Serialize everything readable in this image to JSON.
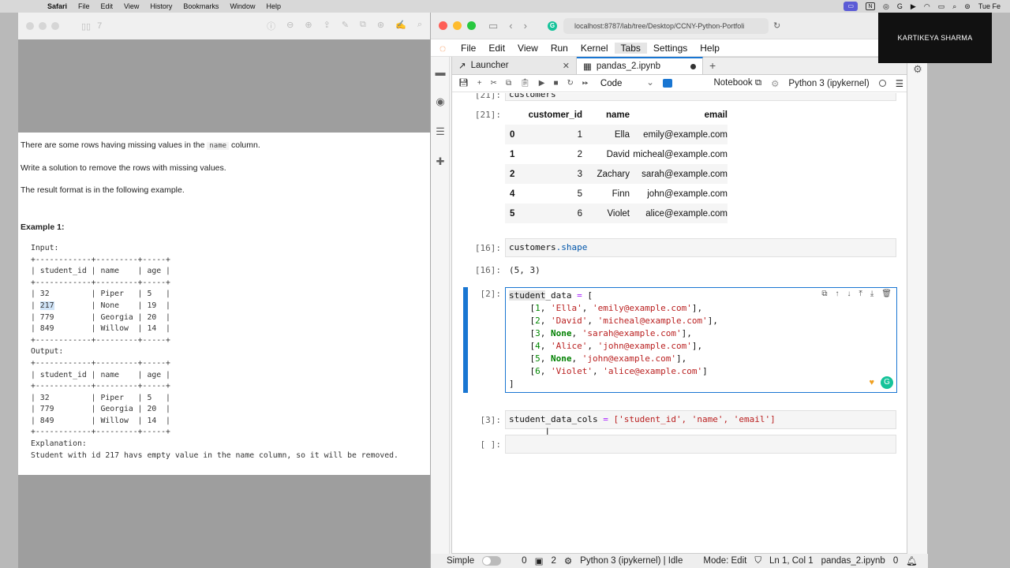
{
  "menubar": {
    "app": "Safari",
    "items": [
      "File",
      "Edit",
      "View",
      "History",
      "Bookmarks",
      "Window",
      "Help"
    ],
    "clock": "Tue Fe"
  },
  "safari_left": {
    "tab_count": "7",
    "problem": {
      "line1_pre": "There are some rows having missing values in the",
      "line1_code": "name",
      "line1_post": "column.",
      "line2": "Write a solution to remove the rows with missing values.",
      "line3": "The result format is in the following example.",
      "example_title": "Example 1:",
      "input_label": "Input:",
      "sep": "+------------+---------+-----+",
      "header": "| student_id | name    | age |",
      "input_rows": [
        [
          "| 32         | Piper   | 5   |"
        ],
        [
          "| ",
          "217",
          "        | None    | 19  |"
        ],
        [
          "| 779        | Georgia | 20  |"
        ],
        [
          "| 849        | Willow  | 14  |"
        ]
      ],
      "output_label": "Output:",
      "output_rows": [
        "| 32         | Piper   | 5   |",
        "| 779        | Georgia | 20  |",
        "| 849        | Willow  | 14  |"
      ],
      "explanation_label": "Explanation:",
      "explanation": "Student with id 217 havs empty value in the name column, so it will be removed."
    }
  },
  "browser": {
    "url": "localhost:8787/lab/tree/Desktop/CCNY-Python-Portfoli"
  },
  "jupyter": {
    "menu": [
      "File",
      "Edit",
      "View",
      "Run",
      "Kernel",
      "Tabs",
      "Settings",
      "Help"
    ],
    "tabs": [
      {
        "label": "Launcher"
      },
      {
        "label": "pandas_2.ipynb"
      }
    ],
    "toolbar": {
      "cell_type": "Code",
      "notebook_label": "Notebook",
      "kernel": "Python 3 (ipykernel)"
    },
    "cells": {
      "c21_top_text": "customers",
      "c21_prompt": "[21]:",
      "df_headers": [
        "",
        "customer_id",
        "name",
        "email"
      ],
      "df_rows": [
        [
          "0",
          "1",
          "Ella",
          "emily@example.com"
        ],
        [
          "1",
          "2",
          "David",
          "micheal@example.com"
        ],
        [
          "2",
          "3",
          "Zachary",
          "sarah@example.com"
        ],
        [
          "4",
          "5",
          "Finn",
          "john@example.com"
        ],
        [
          "5",
          "6",
          "Violet",
          "alice@example.com"
        ]
      ],
      "c16_prompt": "[16]:",
      "c16_code_var": "customers",
      "c16_code_attr": ".shape",
      "c16_out_prompt": "[16]:",
      "c16_out": "(5, 3)",
      "c2_prompt": "[2]:",
      "c3_prompt": "[3]:",
      "c3_var": "student_data_cols",
      "c3_list": "['student_id', 'name', 'email']",
      "empty_prompt": "[ ]:"
    },
    "status": {
      "mode_toggle": "Simple",
      "n0": "0",
      "n2": "2",
      "kernel_status": "Python 3 (ipykernel) | Idle",
      "mode": "Mode: Edit",
      "position": "Ln 1, Col 1",
      "file": "pandas_2.ipynb",
      "notif": "0"
    }
  },
  "webcam": {
    "name": "KARTIKEYA SHARMA"
  }
}
